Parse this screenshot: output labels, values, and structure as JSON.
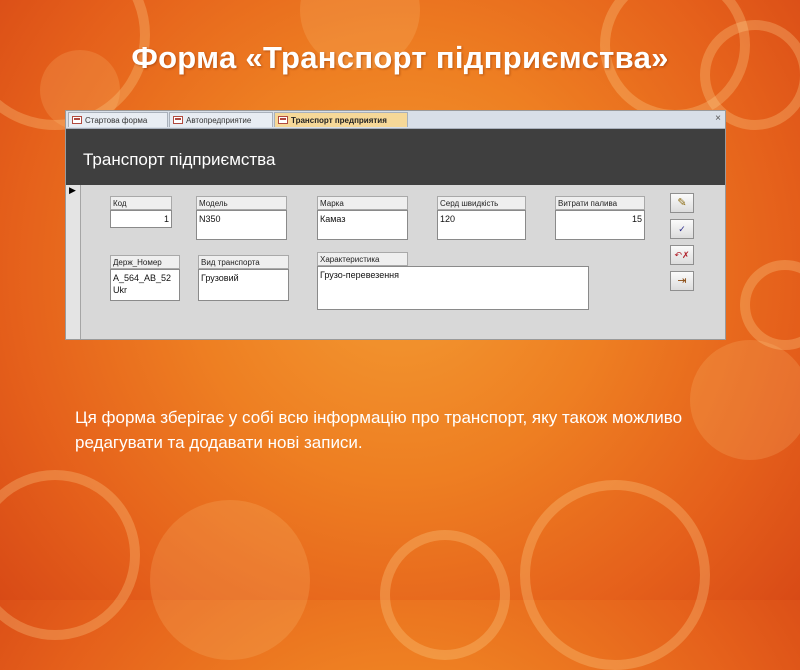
{
  "slide": {
    "title": "Форма «Транспорт підприємства»",
    "description": "Ця форма зберігає у собі всю інформацію про транспорт, яку також можливо редагувати та додавати нові записи."
  },
  "tabs": [
    {
      "label": "Стартова форма",
      "active": false
    },
    {
      "label": "Автопредприятие",
      "active": false
    },
    {
      "label": "Транспорт предприятия",
      "active": true
    }
  ],
  "window": {
    "close_glyph": "×"
  },
  "form": {
    "title": "Транспорт підприємства",
    "record_selector_glyph": "▶",
    "fields": {
      "kod": {
        "label": "Код",
        "value": "1"
      },
      "model": {
        "label": "Модель",
        "value": "N350"
      },
      "marka": {
        "label": "Марка",
        "value": "Камаз"
      },
      "speed": {
        "label": "Серд швидкість",
        "value": "120"
      },
      "fuel": {
        "label": "Витрати палива",
        "value": "15"
      },
      "plate": {
        "label": "Держ_Номер",
        "value": "A_564_AB_52 Ukr"
      },
      "type": {
        "label": "Вид транспорта",
        "value": "Грузовий"
      },
      "desc": {
        "label": "Характеристика",
        "value": "Грузо-перевезення"
      }
    },
    "buttons": [
      {
        "icon": "pencil-icon",
        "glyph": "✎"
      },
      {
        "icon": "checkmark-icon",
        "glyph": "✓"
      },
      {
        "icon": "undo-delete-icon",
        "glyph": "↶✗"
      },
      {
        "icon": "exit-door-icon",
        "glyph": "⇥"
      }
    ]
  },
  "colors": {
    "background": "#ee7f22",
    "form_header": "#3f3f3f",
    "active_tab": "#f6d898"
  }
}
